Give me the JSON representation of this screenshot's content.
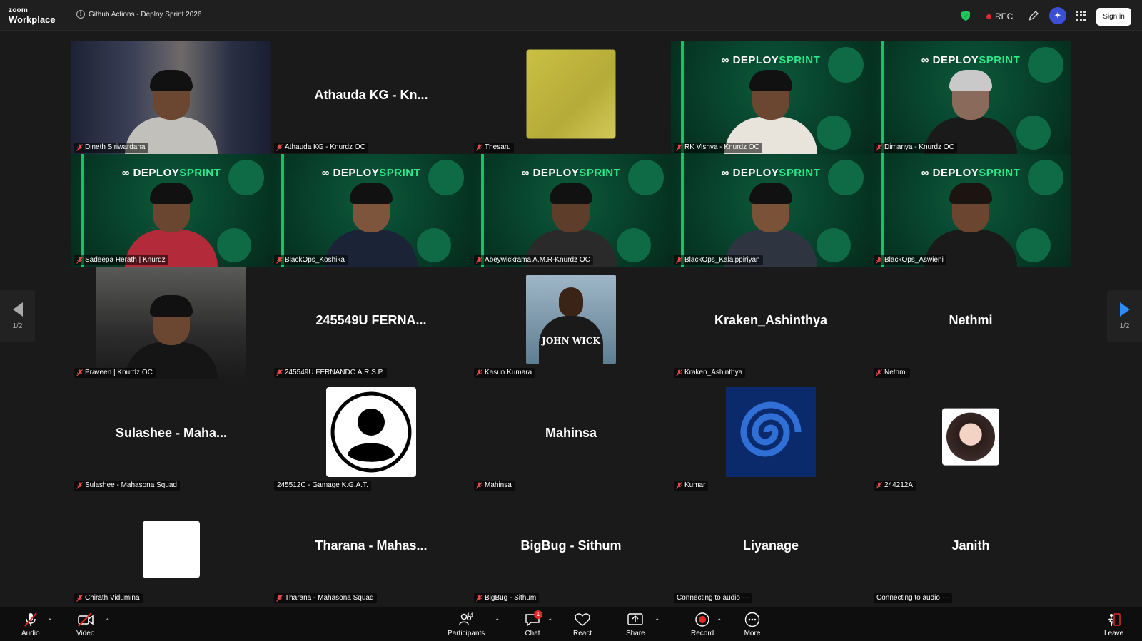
{
  "app": {
    "logo_line1": "zoom",
    "logo_line2": "Workplace"
  },
  "meeting": {
    "title": "Github Actions - Deploy Sprint 2026"
  },
  "header": {
    "rec_label": "REC",
    "signin_label": "Sign in"
  },
  "sprint_banner": {
    "left": "DEPLOY",
    "right": "SPRINT"
  },
  "pagination": {
    "left_page": "1/2",
    "right_page": "1/2"
  },
  "tiles": [
    {
      "name": "Dineth Siriwardana",
      "kind": "video"
    },
    {
      "name": "Athauda KG - Knurdz OC",
      "big": "Athauda KG - Kn...",
      "kind": "name"
    },
    {
      "name": "Thesaru",
      "kind": "yellow"
    },
    {
      "name": "RK Vishva  - Knurdz OC",
      "kind": "sprint"
    },
    {
      "name": "Dimanya - Knurdz OC",
      "kind": "sprint",
      "active": true
    },
    {
      "name": "Sadeepa Herath | Knurdz",
      "kind": "sprint"
    },
    {
      "name": "BlackOps_Koshika",
      "kind": "sprint"
    },
    {
      "name": "Abeywickrama A.M.R-Knurdz OC",
      "kind": "sprint"
    },
    {
      "name": "BlackOps_Kalaippiriyan",
      "kind": "sprint"
    },
    {
      "name": "BlackOps_Aswieni",
      "kind": "sprint"
    },
    {
      "name": "Praveen | Knurdz OC",
      "kind": "video"
    },
    {
      "name": "245549U FERNANDO A.R.S.P.",
      "big": "245549U  FERNA...",
      "kind": "name"
    },
    {
      "name": "Kasun Kumara",
      "kind": "photo"
    },
    {
      "name": "Kraken_Ashinthya",
      "big": "Kraken_Ashinthya",
      "kind": "name"
    },
    {
      "name": "Nethmi",
      "big": "Nethmi",
      "kind": "name"
    },
    {
      "name": "Sulashee - Mahasona Squad",
      "big": "Sulashee  -  Maha...",
      "kind": "name"
    },
    {
      "name": "245512C - Gamage K.G.A.T.",
      "kind": "default-avatar",
      "no_mic": true
    },
    {
      "name": "Mahinsa",
      "big": "Mahinsa",
      "kind": "name"
    },
    {
      "name": "Kumar",
      "kind": "spiral"
    },
    {
      "name": "244212A",
      "kind": "anime"
    },
    {
      "name": "Chirath Vidumina",
      "kind": "white"
    },
    {
      "name": "Tharana - Mahasona Squad",
      "big": "Tharana  -  Mahas...",
      "kind": "name"
    },
    {
      "name": "BigBug - Sithum",
      "big": "BigBug  -  Sithum",
      "kind": "name"
    },
    {
      "name": "Connecting to audio ···",
      "big": "Liyanage",
      "kind": "name",
      "connecting": true
    },
    {
      "name": "Connecting to audio ···",
      "big": "Janith",
      "kind": "name",
      "connecting": true
    }
  ],
  "toolbar": {
    "audio": "Audio",
    "video": "Video",
    "participants": "Participants",
    "participants_count": "44",
    "chat": "Chat",
    "chat_badge": "1",
    "react": "React",
    "share": "Share",
    "record": "Record",
    "more": "More",
    "leave": "Leave"
  },
  "colors": {
    "accent": "#2d8cff",
    "active_speaker": "#2ecc71",
    "record": "#e02828",
    "sprint_green": "#2ee88a"
  }
}
